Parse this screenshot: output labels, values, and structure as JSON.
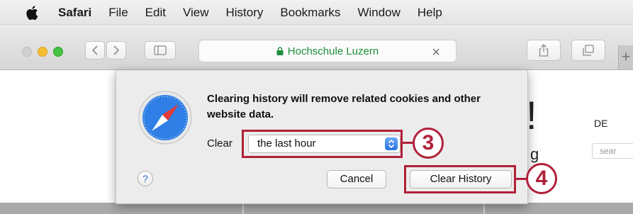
{
  "menubar": {
    "app": "Safari",
    "items": [
      "File",
      "Edit",
      "View",
      "History",
      "Bookmarks",
      "Window",
      "Help"
    ]
  },
  "toolbar": {
    "url": "Hochschule Luzern",
    "new_tab": "+",
    "url_clear": "×"
  },
  "page": {
    "heading_fragment": "!",
    "text_fragment": "g",
    "language": "DE",
    "search_placeholder": "sear"
  },
  "dialog": {
    "message": "Clearing history will remove related cookies and other website data.",
    "clear_label": "Clear",
    "selected_range": "the last hour",
    "help": "?",
    "cancel": "Cancel",
    "clear_history": "Clear History"
  },
  "callouts": {
    "step3": "3",
    "step4": "4"
  },
  "colors": {
    "accent": "#b0213a",
    "url_green": "#1e8f3a"
  }
}
